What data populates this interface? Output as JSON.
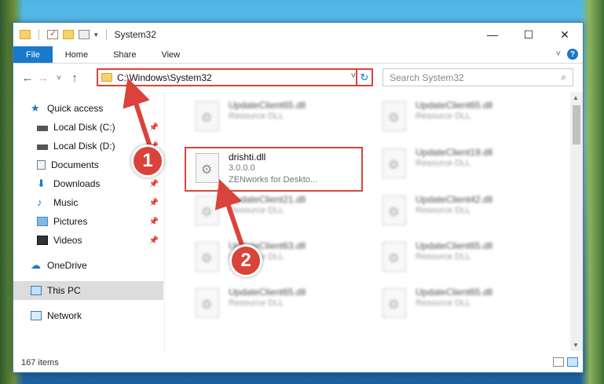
{
  "window": {
    "title": "System32",
    "controls": {
      "minimize": "—",
      "maximize": "☐",
      "close": "✕"
    }
  },
  "ribbon": {
    "tabs": [
      "File",
      "Home",
      "Share",
      "View"
    ],
    "expand": "˅",
    "help": "?"
  },
  "navigation": {
    "back": "←",
    "forward": "→",
    "recent": "˅",
    "up": "↑",
    "address_path": "C:\\Windows\\System32",
    "address_dropdown": "˅",
    "refresh": "↻",
    "search_placeholder": "Search System32",
    "search_icon": "⌕"
  },
  "sidebar": {
    "items": [
      {
        "label": "Quick access",
        "icon": "star-icon",
        "pinned": false
      },
      {
        "label": "Local Disk (C:)",
        "icon": "drive-icon",
        "pinned": true
      },
      {
        "label": "Local Disk (D:)",
        "icon": "drive-icon",
        "pinned": true
      },
      {
        "label": "Documents",
        "icon": "documents-icon",
        "pinned": true
      },
      {
        "label": "Downloads",
        "icon": "download-icon",
        "pinned": true
      },
      {
        "label": "Music",
        "icon": "music-icon",
        "pinned": true
      },
      {
        "label": "Pictures",
        "icon": "pictures-icon",
        "pinned": true
      },
      {
        "label": "Videos",
        "icon": "videos-icon",
        "pinned": true
      },
      {
        "label": "OneDrive",
        "icon": "cloud-icon",
        "pinned": false
      },
      {
        "label": "This PC",
        "icon": "computer-icon",
        "pinned": false,
        "selected": true
      },
      {
        "label": "Network",
        "icon": "network-icon",
        "pinned": false
      }
    ],
    "pin_glyph": "📌"
  },
  "files": {
    "left_column": [
      {
        "name": "UpdateClient65.dll",
        "line2": "Resource DLL"
      },
      {
        "name": "drishti.dll",
        "line2": "3.0.0.0",
        "line3": "ZENworks for Deskto...",
        "highlighted": true
      },
      {
        "name": "UpdateClient21.dll",
        "line2": "Resource DLL"
      },
      {
        "name": "UpdateClient63.dll",
        "line2": "Resource DLL"
      },
      {
        "name": "UpdateClient65.dll",
        "line2": "Resource DLL"
      }
    ],
    "right_column": [
      {
        "name": "UpdateClient65.dll",
        "line2": "Resource DLL"
      },
      {
        "name": "UpdateClient19.dll",
        "line2": "Resource DLL"
      },
      {
        "name": "UpdateClient42.dll",
        "line2": "Resource DLL"
      },
      {
        "name": "UpdateClient65.dll",
        "line2": "Resource DLL"
      },
      {
        "name": "UpdateClient65.dll",
        "line2": "Resource DLL"
      }
    ]
  },
  "status": {
    "item_count": "167 items"
  },
  "callouts": [
    "1",
    "2"
  ],
  "colors": {
    "accent": "#1979ca",
    "annotation_red": "#d9433b"
  }
}
